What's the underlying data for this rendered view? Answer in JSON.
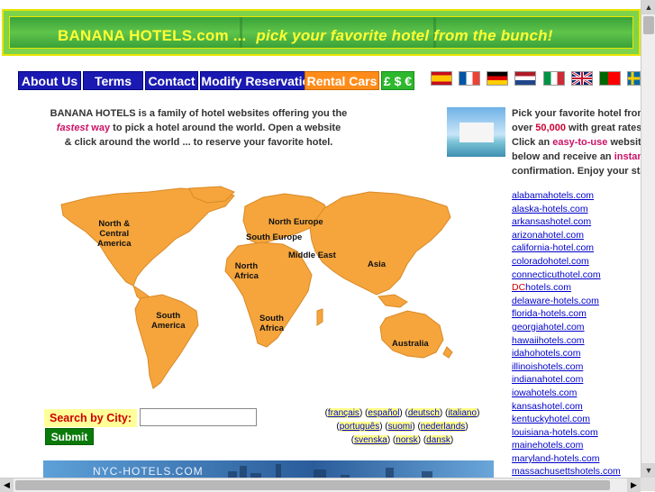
{
  "banner": {
    "site_name": "BANANA HOTELS.com ...",
    "tagline": "pick your favorite hotel from the bunch!"
  },
  "nav": {
    "items": [
      "About Us",
      "Terms",
      "Contact",
      "Modify Reservation",
      "Rental Cars",
      "£ $ €"
    ]
  },
  "flags": [
    "spanish-flag",
    "french-flag",
    "german-flag",
    "dutch-flag",
    "italian-flag",
    "uk-flag",
    "portuguese-flag",
    "swedish-flag"
  ],
  "intro": {
    "line1": "BANANA HOTELS  is a family of hotel websites offering you the",
    "fastest": "fastest",
    "way": " way",
    "line2_rest": " to pick a hotel around the world.  Open a website",
    "line3": "& click around the world ... to reserve your favorite hotel."
  },
  "map": {
    "regions": {
      "north_america": [
        "North &",
        "Central",
        "America"
      ],
      "north_europe": "North Europe",
      "south_europe": "South Europe",
      "middle_east": "Middle East",
      "north_africa": [
        "North",
        "Africa"
      ],
      "asia": "Asia",
      "south_america": [
        "South",
        "America"
      ],
      "south_africa": [
        "South",
        "Africa"
      ],
      "australia": "Australia"
    }
  },
  "search": {
    "label": "Search by City:",
    "submit": "Submit",
    "value": ""
  },
  "languages": [
    "français",
    "español",
    "deutsch",
    "italiano",
    "português",
    "suomi",
    "nederlands",
    "svenska",
    "norsk",
    "dansk"
  ],
  "bottom_banner": {
    "label": "NYC-HOTELS.COM"
  },
  "right": {
    "l1": "Pick your favorite hotel from",
    "l2_a": "over ",
    "l2_b": "50,000",
    "l2_c": " with great rates",
    "l3_a": "Click an ",
    "l3_b": "easy-to-use",
    "l3_c": " website",
    "l4_a": "below and receive an ",
    "l4_b": "instant",
    "l5": "confirmation. Enjoy your sta"
  },
  "links": [
    "alabamahotels.com",
    "alaska-hotels.com",
    "arkansashotel.com",
    "arizonahotel.com",
    "california-hotel.com",
    "coloradohotel.com",
    "connecticuthotel.com",
    "DC",
    "hotels.com",
    "delaware-hotels.com",
    "florida-hotels.com",
    "georgiahotel.com",
    "hawaiihotels.com",
    "idahohotels.com",
    "illinoishotels.com",
    "indianahotel.com",
    "iowahotels.com",
    "kansashotel.com",
    "kentuckyhotel.com",
    "louisiana-hotels.com",
    "mainehotels.com",
    "maryland-hotels.com",
    "massachusettshotels.com"
  ],
  "colors": {
    "banner_green": "#39a23a",
    "banner_text": "#ffff33",
    "nav_blue": "#1a1ab2",
    "nav_orange": "#ff8c1a",
    "nav_green": "#2db82d",
    "map_orange": "#f5a53c",
    "accent_pink": "#cc1166"
  }
}
